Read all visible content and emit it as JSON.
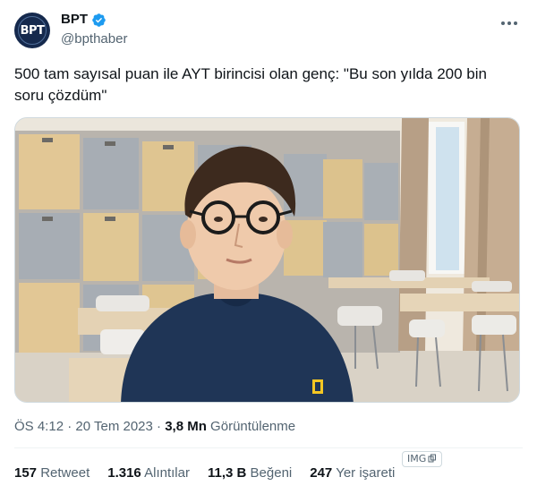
{
  "author": {
    "display_name": "BPT",
    "handle": "@bpthaber",
    "avatar_text": "BPT",
    "verified": true
  },
  "tweet": {
    "text": "500 tam sayısal puan ile AYT birincisi olan genç: \"Bu son yılda 200 bin soru çözdüm\""
  },
  "meta": {
    "time": "ÖS 4:12",
    "sep1": " · ",
    "date": "20 Tem 2023",
    "sep2": " · ",
    "views_count": "3,8 Mn",
    "views_label": " Görüntülenme"
  },
  "stats": [
    {
      "num": "157",
      "label": "Retweet"
    },
    {
      "num": "1.316",
      "label": "Alıntılar"
    },
    {
      "num": "11,3 B",
      "label": "Beğeni"
    },
    {
      "num": "247",
      "label": "Yer işareti"
    }
  ],
  "badge": {
    "label": "IMG"
  },
  "colors": {
    "accent": "#1d9bf0",
    "text": "#0f1419",
    "muted": "#536471"
  }
}
